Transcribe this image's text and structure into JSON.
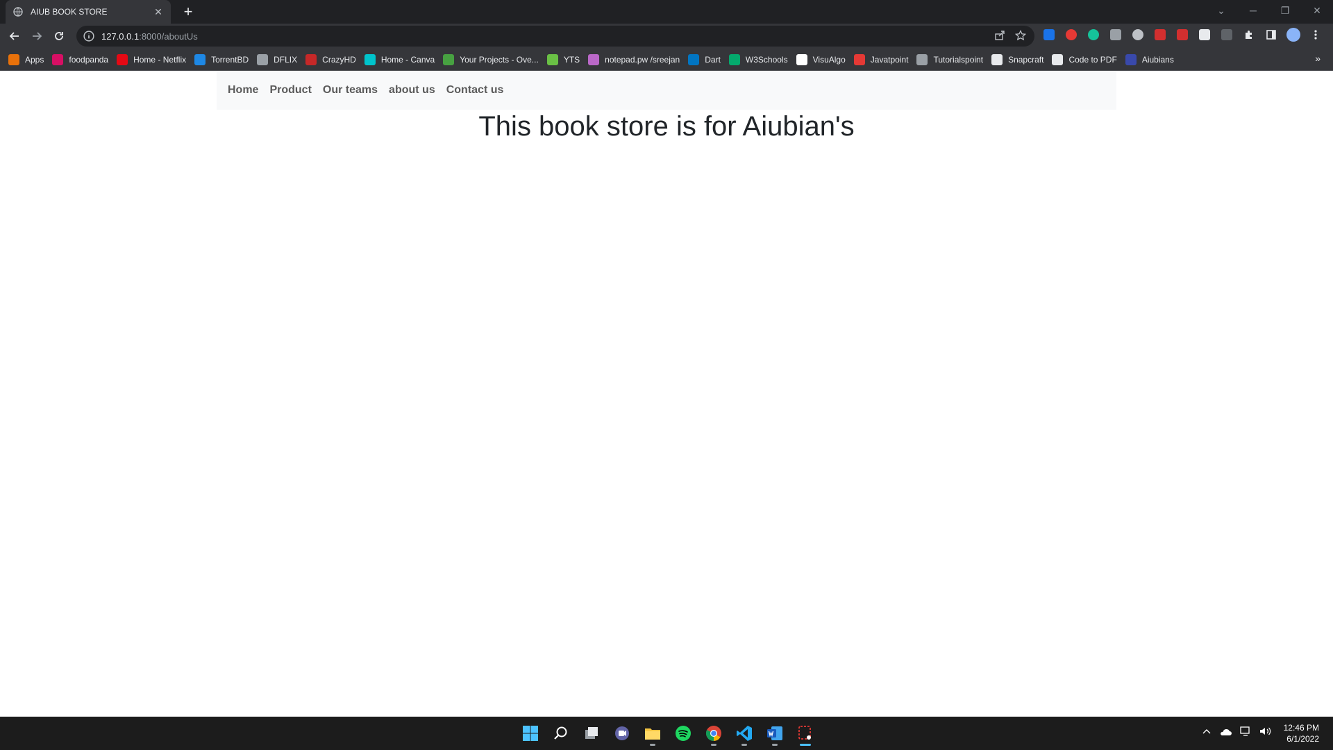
{
  "browser": {
    "tab_title": "AIUB BOOK STORE",
    "url_host": "127.0.0.1",
    "url_path": ":8000/aboutUs"
  },
  "bookmarks": [
    {
      "label": "Apps",
      "icon": "apps-grid-icon",
      "color": "#e8710a"
    },
    {
      "label": "foodpanda",
      "icon": "foodpanda-icon",
      "color": "#d70f64"
    },
    {
      "label": "Home - Netflix",
      "icon": "netflix-icon",
      "color": "#e50914"
    },
    {
      "label": "TorrentBD",
      "icon": "torrentbd-icon",
      "color": "#1e88e5"
    },
    {
      "label": "DFLIX",
      "icon": "dflix-icon",
      "color": "#9aa0a6"
    },
    {
      "label": "CrazyHD",
      "icon": "crazyhd-icon",
      "color": "#c62828"
    },
    {
      "label": "Home - Canva",
      "icon": "canva-icon",
      "color": "#00c4cc"
    },
    {
      "label": "Your Projects - Ove...",
      "icon": "overleaf-icon",
      "color": "#47a141"
    },
    {
      "label": "YTS",
      "icon": "yts-icon",
      "color": "#6ac045"
    },
    {
      "label": "notepad.pw /sreejan",
      "icon": "notepad-icon",
      "color": "#ba68c8"
    },
    {
      "label": "Dart",
      "icon": "dart-icon",
      "color": "#0175c2"
    },
    {
      "label": "W3Schools",
      "icon": "w3schools-icon",
      "color": "#04aa6d"
    },
    {
      "label": "VisuAlgo",
      "icon": "visualgo-icon",
      "color": "#ffffff"
    },
    {
      "label": "Javatpoint",
      "icon": "javatpoint-icon",
      "color": "#e53935"
    },
    {
      "label": "Tutorialspoint",
      "icon": "tutorialspoint-icon",
      "color": "#9aa0a6"
    },
    {
      "label": "Snapcraft",
      "icon": "snapcraft-icon",
      "color": "#e8eaed"
    },
    {
      "label": "Code to PDF",
      "icon": "code-to-pdf-icon",
      "color": "#e8eaed"
    },
    {
      "label": "Aiubians",
      "icon": "aiubians-icon",
      "color": "#3949ab"
    }
  ],
  "navbar": {
    "links": [
      "Home",
      "Product",
      "Our teams",
      "about us",
      "Contact us"
    ]
  },
  "page": {
    "heading": "This book store is for Aiubian's"
  },
  "taskbar": {
    "time": "12:46 PM",
    "date": "6/1/2022"
  },
  "colors": {
    "navbar_bg": "#f8f9fa",
    "nav_link": "#5a5a5a",
    "heading": "#212529",
    "chrome_dark": "#202124",
    "chrome_mid": "#35363a",
    "taskbar": "#1c1c1c",
    "accent": "#4cc2ff"
  }
}
